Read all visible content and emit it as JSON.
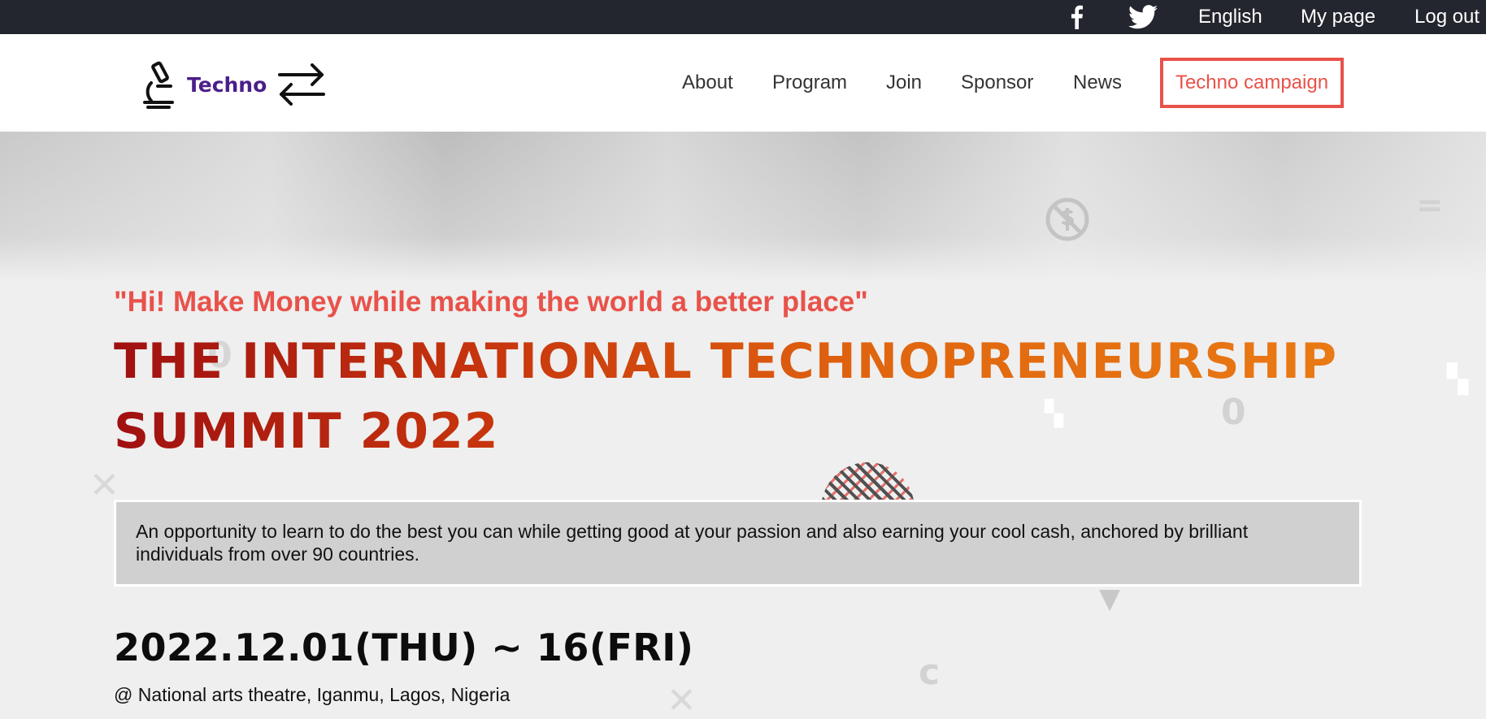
{
  "topbar": {
    "facebook_icon": "facebook-icon",
    "twitter_icon": "twitter-icon",
    "language": "English",
    "my_page": "My page",
    "log_out": "Log out"
  },
  "header": {
    "logo_text": "Techno",
    "nav": {
      "about": "About",
      "program": "Program",
      "join": "Join",
      "sponsor": "Sponsor",
      "news": "News"
    },
    "campaign_button": "Techno campaign"
  },
  "hero": {
    "tagline": "\"Hi! Make Money while making the world a better place\"",
    "headline": "THE INTERNATIONAL TECHNOPRENEURSHIP SUMMIT 2022",
    "description": "An opportunity to learn to do the best you can while getting good at your passion and also earning your cool cash, anchored by brilliant individuals from over 90 countries.",
    "date": "2022.12.01(THU) ~ 16(FRI)",
    "venue": "@ National arts theatre, Iganmu, Lagos, Nigeria"
  },
  "colors": {
    "topbar_bg": "#23262e",
    "accent": "#e8524a",
    "logo_purple": "#4b1e8a",
    "headline_start": "#a01010",
    "headline_end": "#ea7c15",
    "desc_box": "#d0d0d0"
  }
}
